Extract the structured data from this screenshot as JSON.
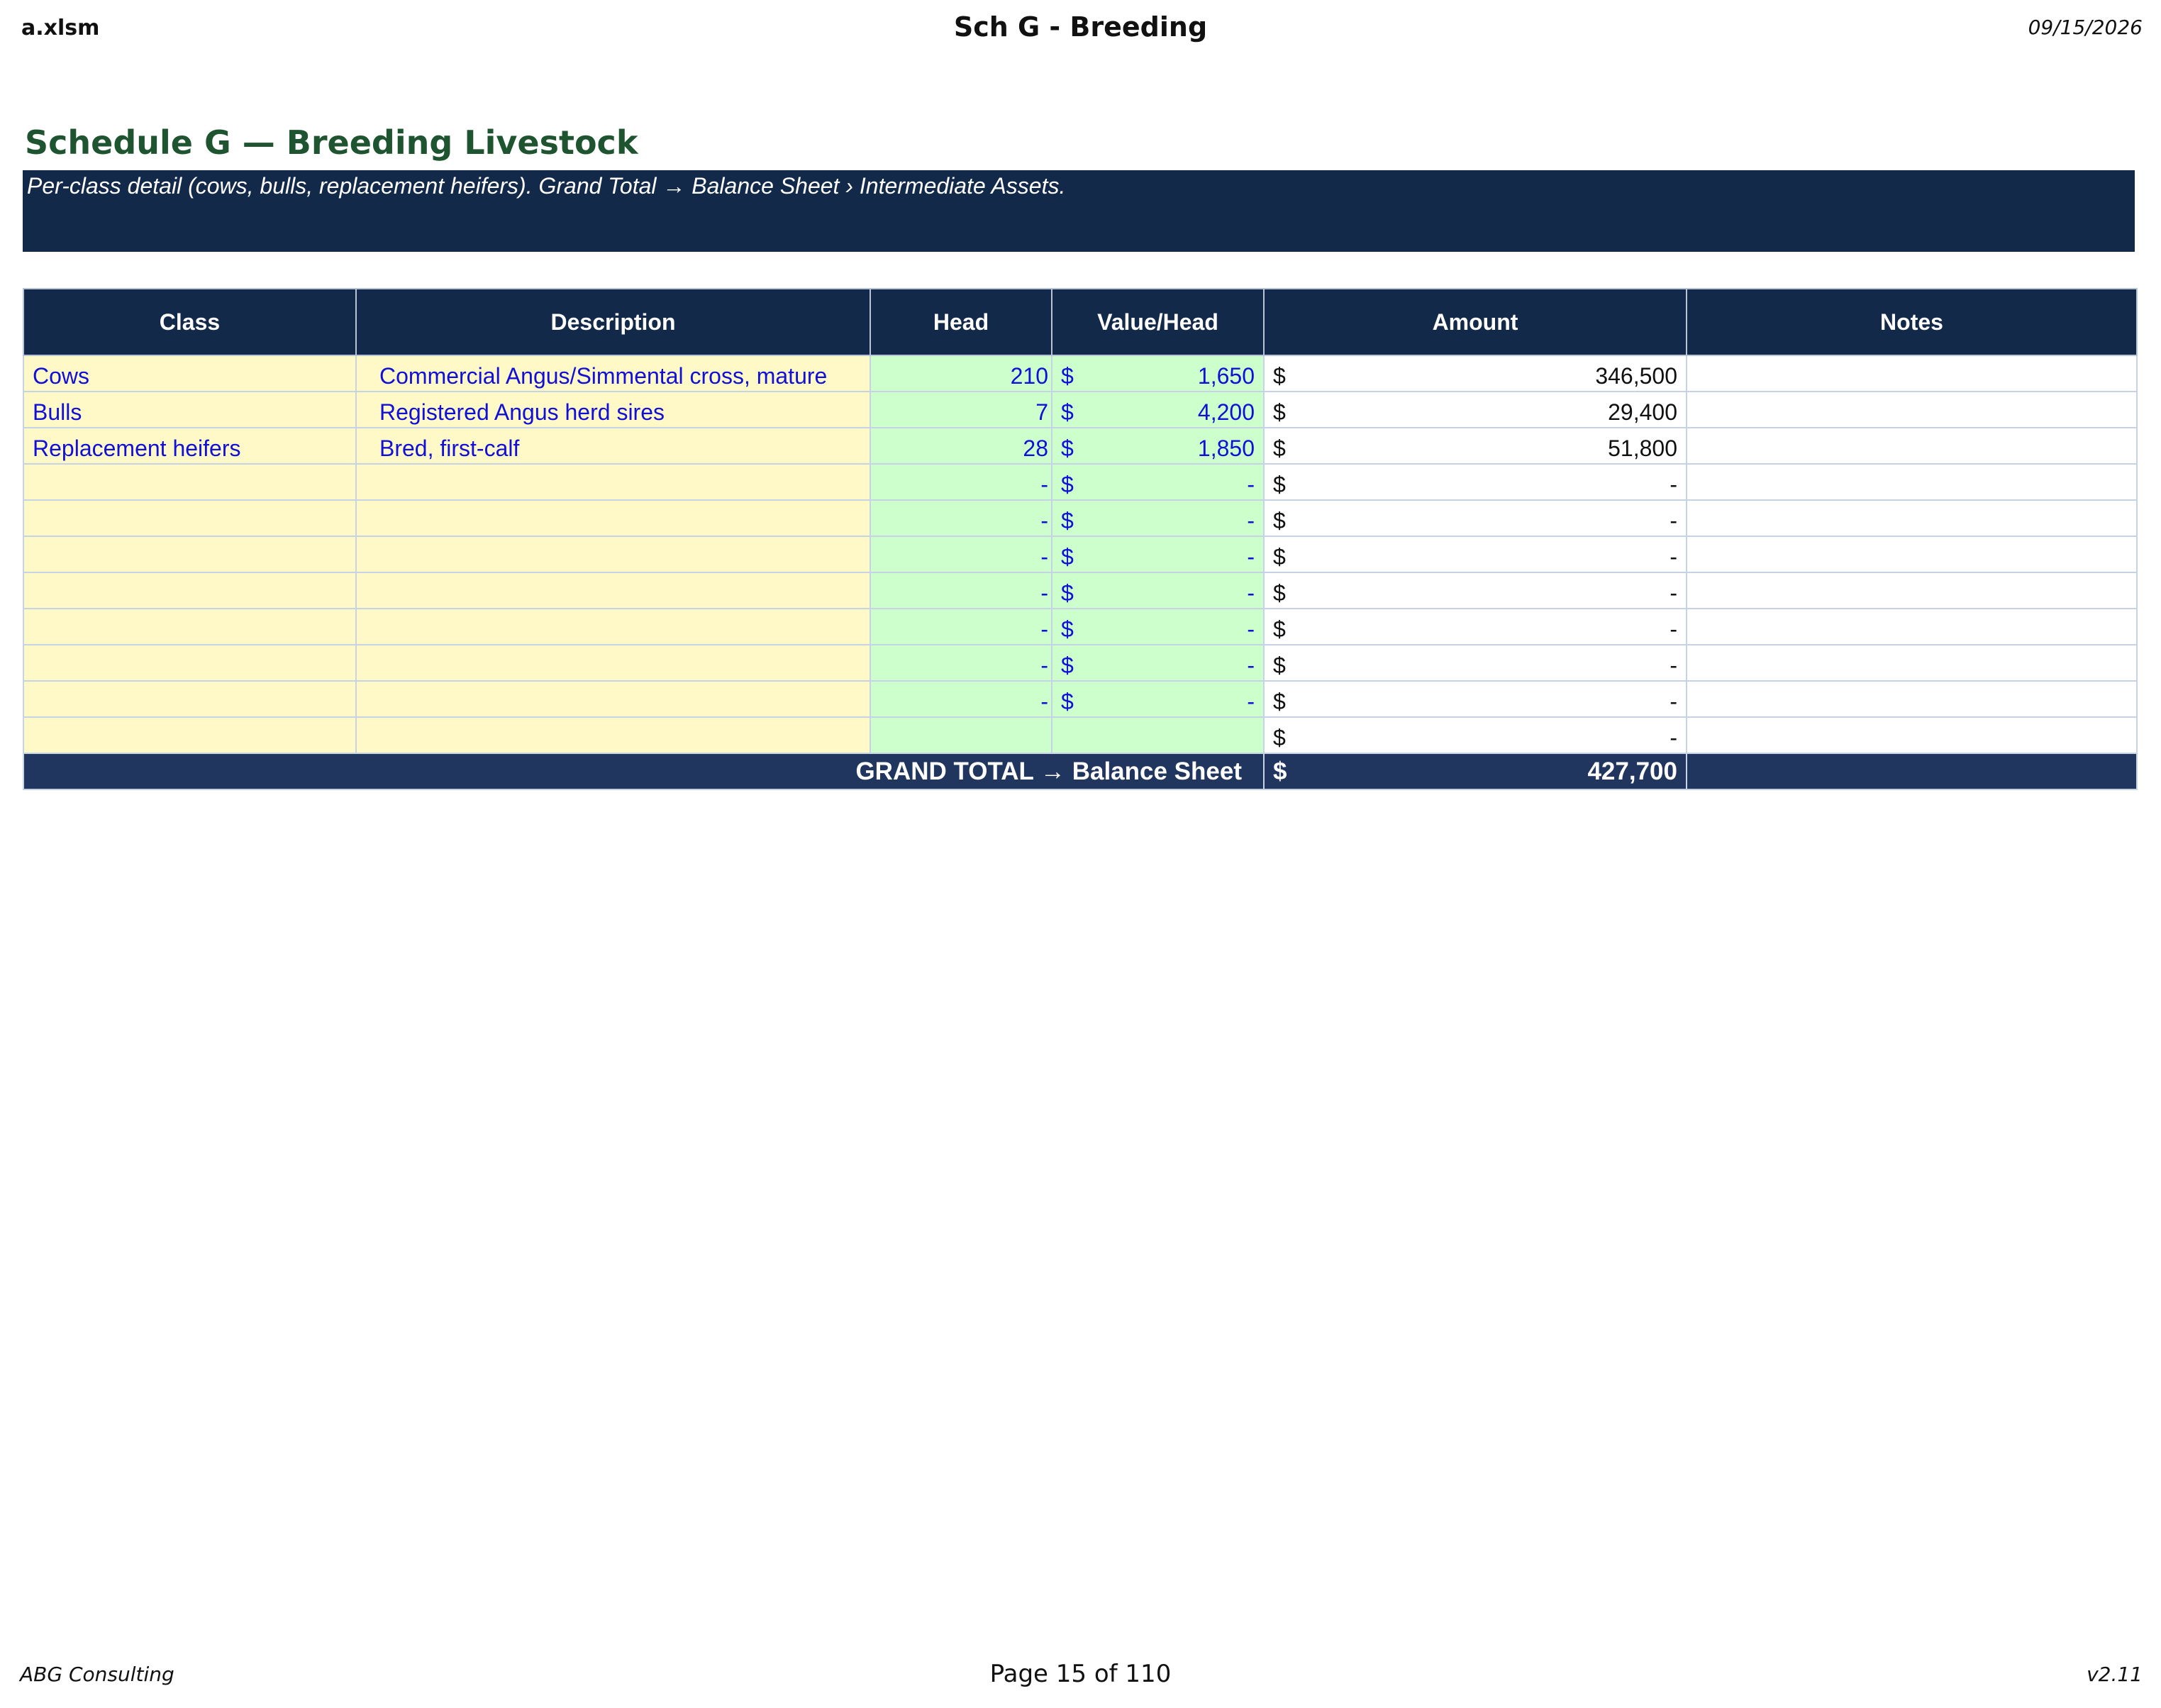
{
  "header": {
    "file_name": "a.xlsm",
    "sheet_title": "Sch G - Breeding",
    "date": "09/15/2026"
  },
  "title": "Schedule G — Breeding Livestock",
  "banner_text": "Per-class detail (cows, bulls, replacement heifers). Grand Total → Balance Sheet › Intermediate Assets.",
  "table": {
    "columns": [
      "Class",
      "Description",
      "Head",
      "Value/Head",
      "Amount",
      "Notes"
    ],
    "currency_symbol": "$",
    "rows": [
      {
        "class": "Cows",
        "description": "Commercial Angus/Simmental cross, mature",
        "head": "210",
        "value_head": "1,650",
        "amount": "346,500",
        "notes": ""
      },
      {
        "class": "Bulls",
        "description": "Registered Angus herd sires",
        "head": "7",
        "value_head": "4,200",
        "amount": "29,400",
        "notes": ""
      },
      {
        "class": "Replacement heifers",
        "description": "Bred, first-calf",
        "head": "28",
        "value_head": "1,850",
        "amount": "51,800",
        "notes": ""
      },
      {
        "class": "",
        "description": "",
        "head": "-",
        "value_head": "-",
        "amount": "-",
        "notes": ""
      },
      {
        "class": "",
        "description": "",
        "head": "-",
        "value_head": "-",
        "amount": "-",
        "notes": ""
      },
      {
        "class": "",
        "description": "",
        "head": "-",
        "value_head": "-",
        "amount": "-",
        "notes": ""
      },
      {
        "class": "",
        "description": "",
        "head": "-",
        "value_head": "-",
        "amount": "-",
        "notes": ""
      },
      {
        "class": "",
        "description": "",
        "head": "-",
        "value_head": "-",
        "amount": "-",
        "notes": ""
      },
      {
        "class": "",
        "description": "",
        "head": "-",
        "value_head": "-",
        "amount": "-",
        "notes": ""
      },
      {
        "class": "",
        "description": "",
        "head": "-",
        "value_head": "-",
        "amount": "-",
        "notes": ""
      },
      {
        "class": "",
        "description": "",
        "head": "",
        "value_head": "",
        "amount": "-",
        "notes": ""
      }
    ],
    "total_label": "GRAND TOTAL → Balance Sheet",
    "total_amount": "427,700"
  },
  "footer": {
    "company": "ABG Consulting",
    "page": "Page 15 of 110",
    "version": "v2.11"
  },
  "colors": {
    "banner_bg": "#12294a",
    "title_green": "#1f5431",
    "input_yellow": "#fff8c7",
    "input_green": "#ccffcc",
    "input_text_blue": "#1010d8",
    "total_bg": "#20365e"
  }
}
